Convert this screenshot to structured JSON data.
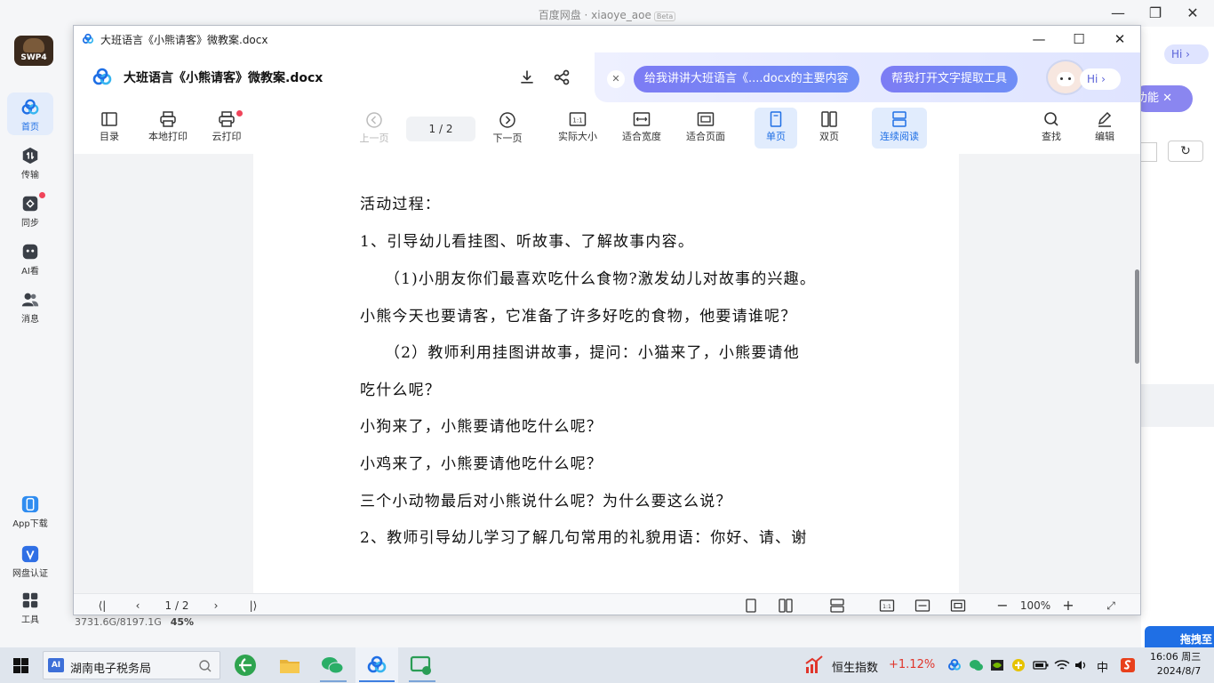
{
  "background_app": {
    "title": "百度网盘 · xiaoye_aoe",
    "title_badge": "Beta",
    "avatar_text": "SWP4",
    "sidebar": [
      {
        "label": "首页",
        "icon": "cloud-logo-icon"
      },
      {
        "label": "传输",
        "icon": "transfer-icon"
      },
      {
        "label": "同步",
        "icon": "sync-icon"
      },
      {
        "label": "AI看",
        "icon": "ai-view-icon"
      },
      {
        "label": "消息",
        "icon": "message-icon"
      },
      {
        "label": "App下载",
        "icon": "phone-icon"
      },
      {
        "label": "网盘认证",
        "icon": "verify-icon"
      },
      {
        "label": "工具",
        "icon": "tools-icon"
      }
    ],
    "storage_text": "3731.6G/8197.1G",
    "storage_percent": "45%",
    "right_hi": "Hi",
    "right_feature_btn": "功能",
    "right_drag_text": "拖拽至"
  },
  "doc_window": {
    "title": "大班语言《小熊请客》微教案.docx",
    "header_title": "大班语言《小熊请客》微教案.docx",
    "ai_pills": [
      "给我讲讲大班语言《....docx的主要内容",
      "帮我打开文字提取工具"
    ],
    "ai_hi": "Hi",
    "toolbar": {
      "toc": "目录",
      "local_print": "本地打印",
      "cloud_print": "云打印",
      "prev_page": "上一页",
      "page_indicator": "1 / 2",
      "next_page": "下一页",
      "actual_size": "实际大小",
      "fit_width": "适合宽度",
      "fit_page": "适合页面",
      "single_page": "单页",
      "double_page": "双页",
      "continuous": "连续阅读",
      "find": "查找",
      "edit": "编辑"
    },
    "content_lines": [
      "活动过程：",
      "1、引导幼儿看挂图、听故事、了解故事内容。",
      "　　（1)小朋友你们最喜欢吃什么食物?激发幼儿对故事的兴趣。",
      "小熊今天也要请客，它准备了许多好吃的食物，他要请谁呢？",
      "　　（2）教师利用挂图讲故事，提问：小猫来了，小熊要请他",
      "吃什么呢？",
      "小狗来了，小熊要请他吃什么呢？",
      "小鸡来了，小熊要请他吃什么呢？",
      "三个小动物最后对小熊说什么呢？为什么要这么说？",
      "2、教师引导幼儿学习了解几句常用的礼貌用语：你好、请、谢"
    ],
    "bottom": {
      "page_current": "1",
      "page_sep": "/",
      "page_total": "2",
      "zoom": "100%",
      "zoom_minus": "−",
      "zoom_plus": "+"
    }
  },
  "taskbar": {
    "search_text": "湖南电子税务局",
    "search_badge": "AI",
    "stock_name": "恒生指数",
    "stock_change": "+1.12%",
    "ime": "中",
    "time": "16:06 周三",
    "date": "2024/8/7"
  },
  "colors": {
    "accent": "#1f6fe5",
    "ai_pill": "#7d7cf4",
    "red_dot": "#f0445a",
    "stock_up": "#e0352b"
  }
}
